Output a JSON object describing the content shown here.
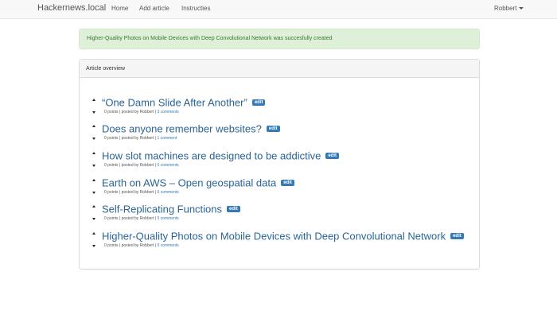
{
  "navbar": {
    "brand": "Hackernews.local",
    "links": [
      "Home",
      "Add article",
      "Instructies"
    ],
    "user": "Robbert"
  },
  "alert": {
    "message": "Higher-Quality Photos on Mobile Devices with Deep Convolutional Network was succesfully created"
  },
  "panel": {
    "heading": "Article overview",
    "edit_label": "edit",
    "articles": [
      {
        "title": "“One Damn Slide After Another”",
        "points": "0 points",
        "posted": "posted by Robbert",
        "comments": "3 comments"
      },
      {
        "title": "Does anyone remember websites?",
        "points": "0 points",
        "posted": "posted by Robbert",
        "comments": "1 comment"
      },
      {
        "title": "How slot machines are designed to be addictive",
        "points": "0 points",
        "posted": "posted by Robbert",
        "comments": "0 comments"
      },
      {
        "title": "Earth on AWS – Open geospatial data",
        "points": "0 points",
        "posted": "posted by Robbert",
        "comments": "0 comments"
      },
      {
        "title": "Self-Replicating Functions",
        "points": "0 points",
        "posted": "posted by Robbert",
        "comments": "0 comments"
      },
      {
        "title": "Higher-Quality Photos on Mobile Devices with Deep Convolutional Network",
        "points": "0 points",
        "posted": "posted by Robbert",
        "comments": "0 comments"
      }
    ]
  }
}
